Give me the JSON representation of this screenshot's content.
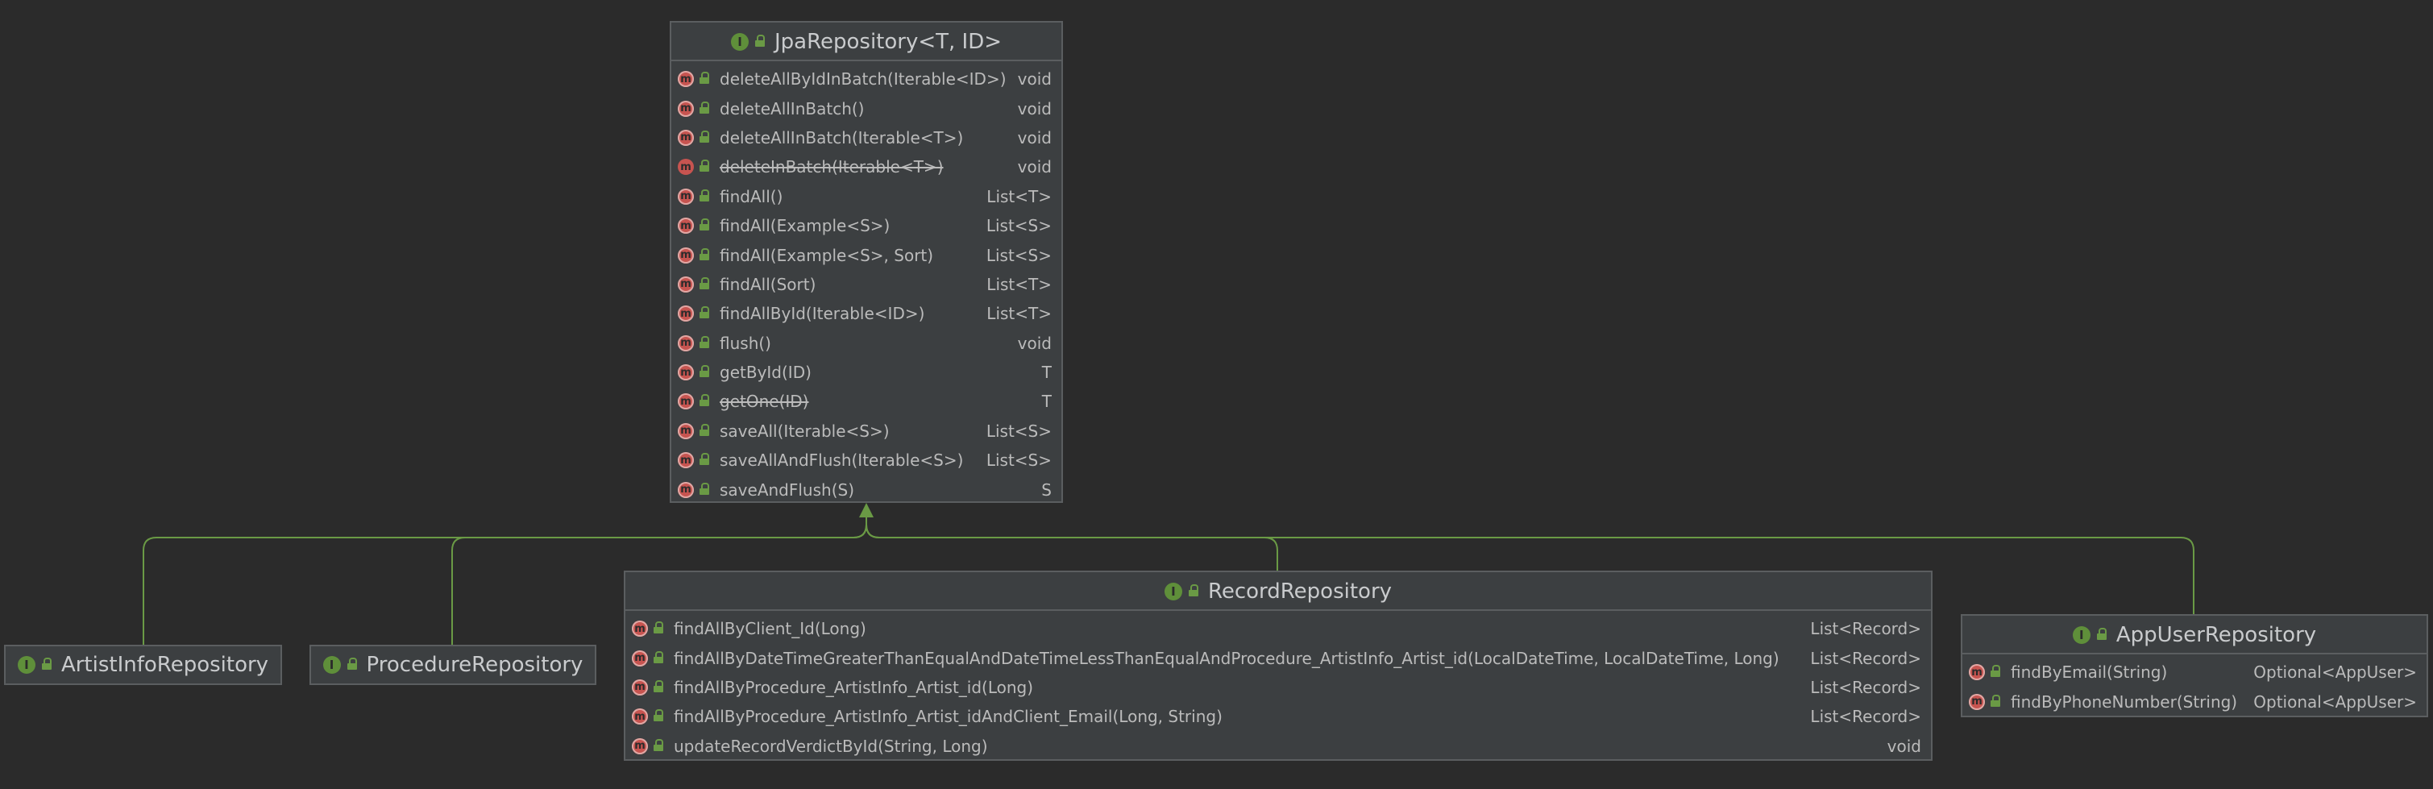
{
  "colors": {
    "background": "#2b2b2b",
    "node_fill": "#3c3f41",
    "node_border": "#5b5e60",
    "edge": "#6a9a45",
    "interface_badge": "#5f8f3a",
    "method_badge": "#c75450"
  },
  "icons": {
    "interface": "interface-icon",
    "method": "abstract-method-icon",
    "visibility": "public-lock-icon"
  },
  "badges": {
    "interface": "I",
    "method": "m"
  },
  "jpa": {
    "title": "JpaRepository<T, ID>",
    "members": [
      {
        "name": "deleteAllByIdInBatch(Iterable<ID>)",
        "type": "void",
        "deprecated": false,
        "abstract": true
      },
      {
        "name": "deleteAllInBatch()",
        "type": "void",
        "deprecated": false,
        "abstract": true
      },
      {
        "name": "deleteAllInBatch(Iterable<T>)",
        "type": "void",
        "deprecated": false,
        "abstract": true
      },
      {
        "name": "deleteInBatch(Iterable<T>)",
        "type": "void",
        "deprecated": true,
        "abstract": false
      },
      {
        "name": "findAll()",
        "type": "List<T>",
        "deprecated": false,
        "abstract": true
      },
      {
        "name": "findAll(Example<S>)",
        "type": "List<S>",
        "deprecated": false,
        "abstract": true
      },
      {
        "name": "findAll(Example<S>, Sort)",
        "type": "List<S>",
        "deprecated": false,
        "abstract": true
      },
      {
        "name": "findAll(Sort)",
        "type": "List<T>",
        "deprecated": false,
        "abstract": true
      },
      {
        "name": "findAllById(Iterable<ID>)",
        "type": "List<T>",
        "deprecated": false,
        "abstract": true
      },
      {
        "name": "flush()",
        "type": "void",
        "deprecated": false,
        "abstract": true
      },
      {
        "name": "getById(ID)",
        "type": "T",
        "deprecated": false,
        "abstract": true
      },
      {
        "name": "getOne(ID)",
        "type": "T",
        "deprecated": true,
        "abstract": true
      },
      {
        "name": "saveAll(Iterable<S>)",
        "type": "List<S>",
        "deprecated": false,
        "abstract": true
      },
      {
        "name": "saveAllAndFlush(Iterable<S>)",
        "type": "List<S>",
        "deprecated": false,
        "abstract": true
      },
      {
        "name": "saveAndFlush(S)",
        "type": "S",
        "deprecated": false,
        "abstract": true
      }
    ]
  },
  "artist": {
    "title": "ArtistInfoRepository"
  },
  "procedure": {
    "title": "ProcedureRepository"
  },
  "record": {
    "title": "RecordRepository",
    "members": [
      {
        "name": "findAllByClient_Id(Long)",
        "type": "List<Record>",
        "deprecated": false,
        "abstract": true
      },
      {
        "name": "findAllByDateTimeGreaterThanEqualAndDateTimeLessThanEqualAndProcedure_ArtistInfo_Artist_id(LocalDateTime, LocalDateTime, Long)",
        "type": "List<Record>",
        "deprecated": false,
        "abstract": true
      },
      {
        "name": "findAllByProcedure_ArtistInfo_Artist_id(Long)",
        "type": "List<Record>",
        "deprecated": false,
        "abstract": true
      },
      {
        "name": "findAllByProcedure_ArtistInfo_Artist_idAndClient_Email(Long, String)",
        "type": "List<Record>",
        "deprecated": false,
        "abstract": true
      },
      {
        "name": "updateRecordVerdictById(String, Long)",
        "type": "void",
        "deprecated": false,
        "abstract": true
      }
    ]
  },
  "appuser": {
    "title": "AppUserRepository",
    "members": [
      {
        "name": "findByEmail(String)",
        "type": "Optional<AppUser>",
        "deprecated": false,
        "abstract": true
      },
      {
        "name": "findByPhoneNumber(String)",
        "type": "Optional<AppUser>",
        "deprecated": false,
        "abstract": true
      }
    ]
  }
}
